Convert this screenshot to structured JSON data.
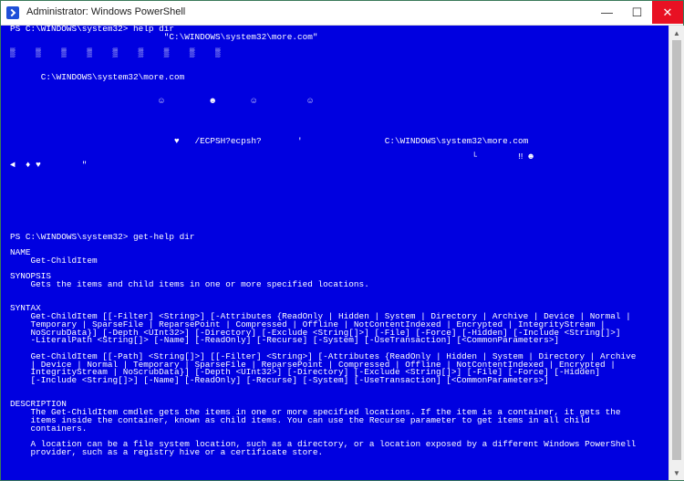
{
  "window": {
    "title": "Administrator: Windows PowerShell",
    "minimize_glyph": "—",
    "maximize_glyph": "☐",
    "close_glyph": "✕"
  },
  "icons": {
    "app": "powershell-icon",
    "scroll_up": "chevron-up-icon",
    "scroll_down": "chevron-down-icon"
  },
  "console": {
    "background_color": "#0000e0",
    "text_color": "#ffffff",
    "lines": [
      {
        "text": "PS C:\\WINDOWS\\system32> help dir"
      },
      {
        "text": "                              \"C:\\WINDOWS\\system32\\more.com\""
      },
      {
        "text": ""
      },
      {
        "text": "▒    ▒    ▒    ▒    ▒    ▒    ▒    ▒    ▒"
      },
      {
        "text": ""
      },
      {
        "text": ""
      },
      {
        "text": "      C:\\WINDOWS\\system32\\more.com"
      },
      {
        "text": ""
      },
      {
        "text": ""
      },
      {
        "text": "                             ☺         ☻       ☺          ☺"
      },
      {
        "text": ""
      },
      {
        "text": ""
      },
      {
        "text": ""
      },
      {
        "text": ""
      },
      {
        "text": "                                ♥   /ECPSH?ecpsh?       '                C:\\WINDOWS\\system32\\more.com"
      },
      {
        "text": ""
      },
      {
        "text": "                                                                                          └        ‼ ☻"
      },
      {
        "text": "◄  ♦ ♥        \""
      },
      {
        "text": ""
      },
      {
        "text": ""
      },
      {
        "text": ""
      },
      {
        "text": ""
      },
      {
        "text": ""
      },
      {
        "text": ""
      },
      {
        "text": ""
      },
      {
        "text": ""
      },
      {
        "text": "PS C:\\WINDOWS\\system32> get-help dir"
      },
      {
        "text": ""
      },
      {
        "text": "NAME"
      },
      {
        "text": "    Get-ChildItem"
      },
      {
        "text": ""
      },
      {
        "text": "SYNOPSIS"
      },
      {
        "text": "    Gets the items and child items in one or more specified locations."
      },
      {
        "text": ""
      },
      {
        "text": ""
      },
      {
        "text": "SYNTAX"
      },
      {
        "text": "    Get-ChildItem [[-Filter] <String>] [-Attributes {ReadOnly | Hidden | System | Directory | Archive | Device | Normal |"
      },
      {
        "text": "    Temporary | SparseFile | ReparsePoint | Compressed | Offline | NotContentIndexed | Encrypted | IntegrityStream |"
      },
      {
        "text": "    NoScrubData}] [-Depth <UInt32>] [-Directory] [-Exclude <String[]>] [-File] [-Force] [-Hidden] [-Include <String[]>]"
      },
      {
        "text": "    -LiteralPath <String[]> [-Name] [-ReadOnly] [-Recurse] [-System] [-UseTransaction] [<CommonParameters>]"
      },
      {
        "text": ""
      },
      {
        "text": "    Get-ChildItem [[-Path] <String[]>] [[-Filter] <String>] [-Attributes {ReadOnly | Hidden | System | Directory | Archive"
      },
      {
        "text": "    | Device | Normal | Temporary | SparseFile | ReparsePoint | Compressed | Offline | NotContentIndexed | Encrypted |"
      },
      {
        "text": "    IntegrityStream | NoScrubData}] [-Depth <UInt32>] [-Directory] [-Exclude <String[]>] [-File] [-Force] [-Hidden]"
      },
      {
        "text": "    [-Include <String[]>] [-Name] [-ReadOnly] [-Recurse] [-System] [-UseTransaction] [<CommonParameters>]"
      },
      {
        "text": ""
      },
      {
        "text": ""
      },
      {
        "text": "DESCRIPTION"
      },
      {
        "text": "    The Get-ChildItem cmdlet gets the items in one or more specified locations. If the item is a container, it gets the"
      },
      {
        "text": "    items inside the container, known as child items. You can use the Recurse parameter to get items in all child"
      },
      {
        "text": "    containers."
      },
      {
        "text": ""
      },
      {
        "text": "    A location can be a file system location, such as a directory, or a location exposed by a different Windows PowerShell"
      },
      {
        "text": "    provider, such as a registry hive or a certificate store."
      }
    ]
  }
}
